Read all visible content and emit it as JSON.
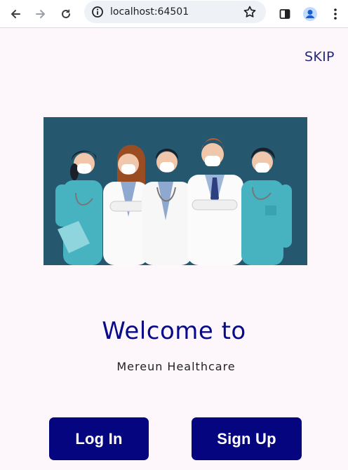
{
  "browser": {
    "url": "localhost:64501",
    "icons": [
      "back-icon",
      "forward-icon",
      "reload-icon",
      "info-icon",
      "star-icon",
      "side-panel-icon",
      "profile-icon",
      "menu-icon"
    ]
  },
  "page": {
    "skip_label": "SKIP",
    "welcome": "Welcome to",
    "subtitle": "Mereun Healthcare",
    "login_label": "Log In",
    "signup_label": "Sign Up"
  },
  "colors": {
    "background": "#fdf7fb",
    "primary": "#05067f",
    "title": "#080a88",
    "skip": "#26287a",
    "hero_bg": "#25576f"
  }
}
